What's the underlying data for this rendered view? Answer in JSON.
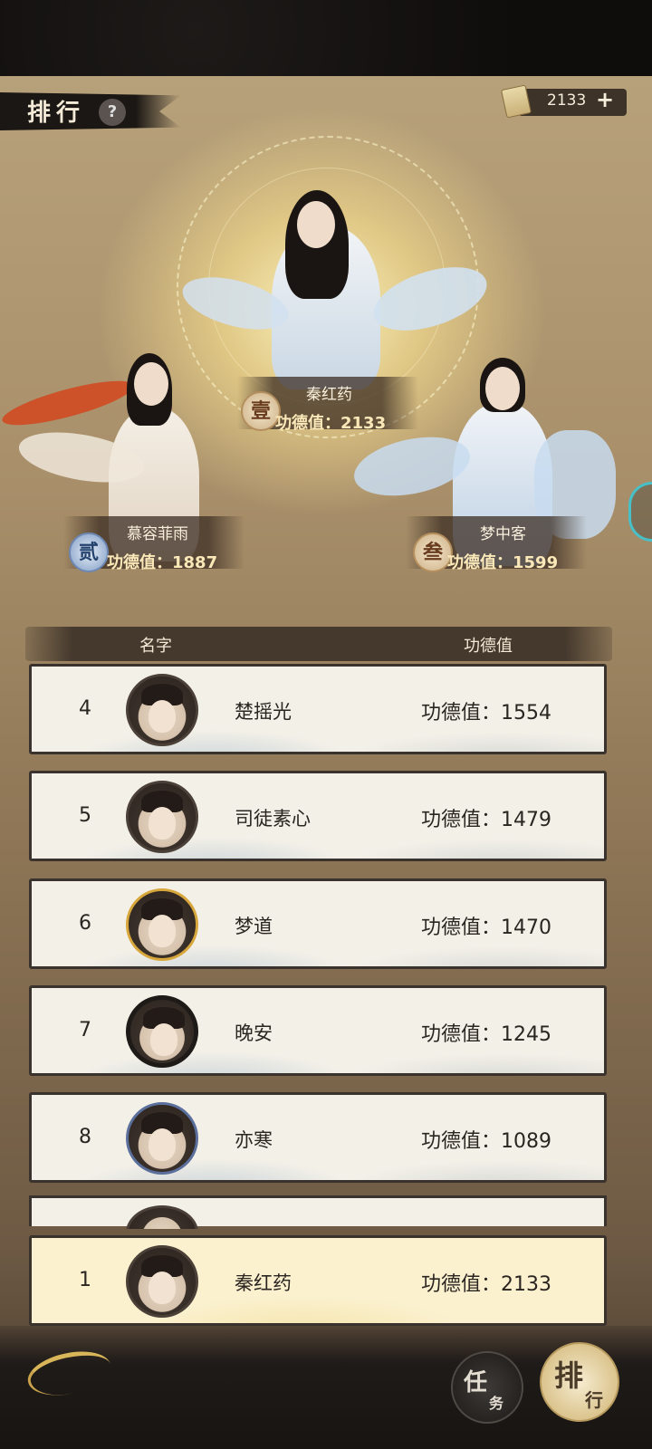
{
  "header": {
    "title": "排行",
    "help_label": "?",
    "currency_value": "2133",
    "plus_label": "+"
  },
  "podium": {
    "first": {
      "badge": "壹",
      "name": "秦红药",
      "score": "功德值：2133"
    },
    "second": {
      "badge": "贰",
      "name": "慕容菲雨",
      "score": "功德值：1887"
    },
    "third": {
      "badge": "叁",
      "name": "梦中客",
      "score": "功德值：1599"
    }
  },
  "table": {
    "col_name": "名字",
    "col_score": "功德值",
    "rows": [
      {
        "rank": "4",
        "name": "楚摇光",
        "score": "功德值：1554"
      },
      {
        "rank": "5",
        "name": "司徒素心",
        "score": "功德值：1479"
      },
      {
        "rank": "6",
        "name": "梦道",
        "score": "功德值：1470"
      },
      {
        "rank": "7",
        "name": "晚安",
        "score": "功德值：1245"
      },
      {
        "rank": "8",
        "name": "亦寒",
        "score": "功德值：1089"
      }
    ]
  },
  "self_row": {
    "rank": "1",
    "name": "秦红药",
    "score": "功德值：2133"
  },
  "nav": {
    "task_big": "任",
    "task_small": "务",
    "rank_big": "排",
    "rank_small": "行"
  }
}
